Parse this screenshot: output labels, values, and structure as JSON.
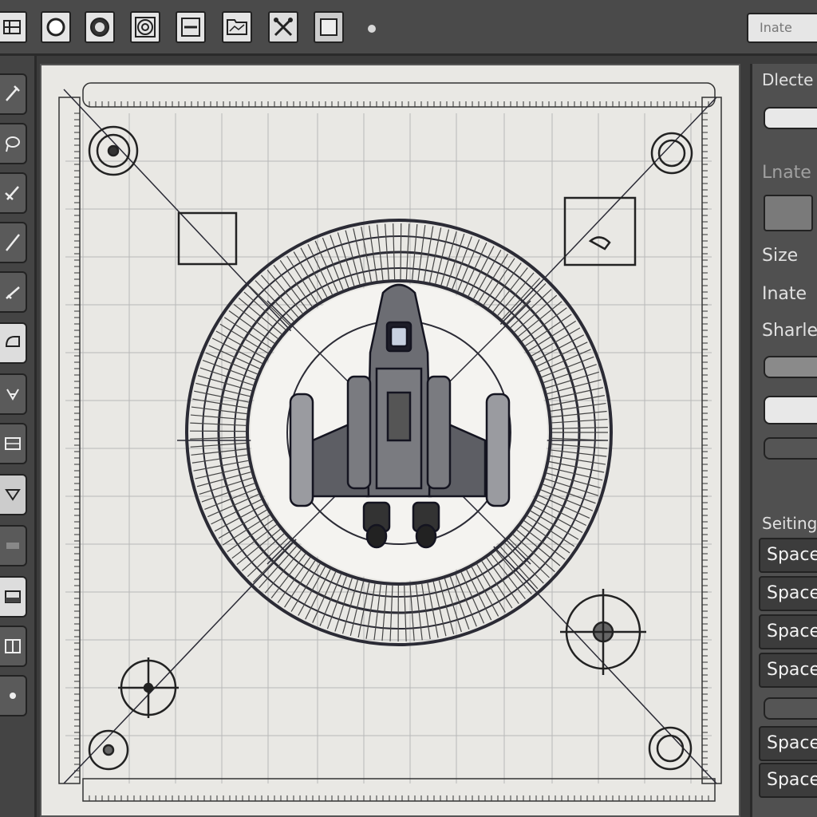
{
  "toolbar": {
    "tools": [
      {
        "name": "select-grid-icon"
      },
      {
        "name": "circle-outline-icon"
      },
      {
        "name": "target-circle-icon"
      },
      {
        "name": "spiral-circle-icon"
      },
      {
        "name": "panel-layout-icon"
      },
      {
        "name": "image-frame-icon"
      },
      {
        "name": "cross-tools-icon"
      },
      {
        "name": "square-icon"
      }
    ],
    "field_text": "Inate"
  },
  "left_tools": [
    "wrench-icon",
    "lasso-icon",
    "brush-icon",
    "pen-icon",
    "ruler-icon",
    "shape-icon",
    "texture-icon",
    "grid-pattern-icon",
    "fill-icon",
    "layer-icon",
    "image-icon",
    "frame-icon",
    "dot-icon"
  ],
  "panel": {
    "header": "Dlecte",
    "label_faded": "Lnate",
    "size_label": "Size",
    "inate_label": "Inate",
    "shader_label": "Sharle",
    "settings_label": "Seiting",
    "items": [
      "Space",
      "Space",
      "Space",
      "Space",
      "Space",
      "Space"
    ]
  },
  "colors": {
    "canvas_bg": "#e9e8e4",
    "line": "#1f1f2a",
    "ui_dark": "#3b3b3b"
  }
}
